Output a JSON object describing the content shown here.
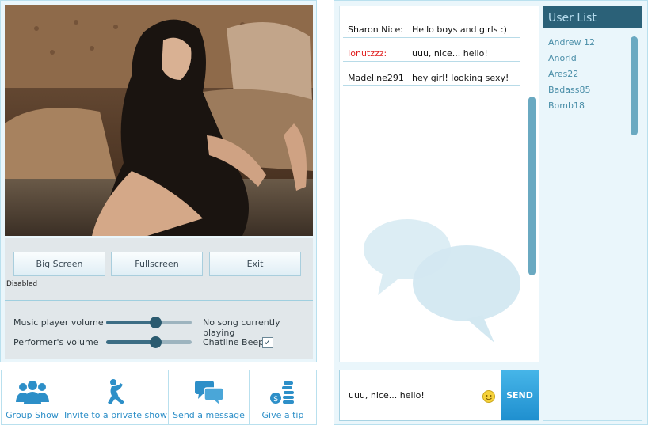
{
  "video": {
    "buttons": {
      "big_screen": "Big Screen",
      "fullscreen": "Fullscreen",
      "exit": "Exit"
    },
    "status_label": "Disabled"
  },
  "audio": {
    "music_label": "Music player volume",
    "music_volume": 0.57,
    "song_status": "No song currently playing",
    "performer_label": "Performer's volume",
    "performer_volume": 0.57,
    "beep_label": "Chatline Beep",
    "beep_checked": true
  },
  "actions": [
    {
      "label": "Group Show",
      "icon": "group-icon"
    },
    {
      "label": "Invite to a private show",
      "icon": "dancer-icon"
    },
    {
      "label": "Send a message",
      "icon": "speech-bubbles-icon"
    },
    {
      "label": "Give a tip",
      "icon": "coins-icon"
    }
  ],
  "chat": {
    "messages": [
      {
        "nick": "Sharon Nice:",
        "text": "Hello boys and girls :)",
        "nick_color": "#111111"
      },
      {
        "nick": "Ionutzzz:",
        "text": "uuu, nice... hello!",
        "nick_color": "#e02020"
      },
      {
        "nick": "Madeline291",
        "text": "hey girl! looking sexy!",
        "nick_color": "#111111"
      }
    ],
    "composer_value": "uuu, nice... hello!",
    "send_label": "SEND"
  },
  "users": {
    "title": "User List",
    "items": [
      "Andrew 12",
      "Anorld",
      "Ares22",
      "Badass85",
      "Bomb18"
    ]
  },
  "colors": {
    "accent": "#2d8fc8",
    "header": "#2b6178",
    "panel_bg": "#eaf6fb",
    "alert_nick": "#e02020"
  }
}
